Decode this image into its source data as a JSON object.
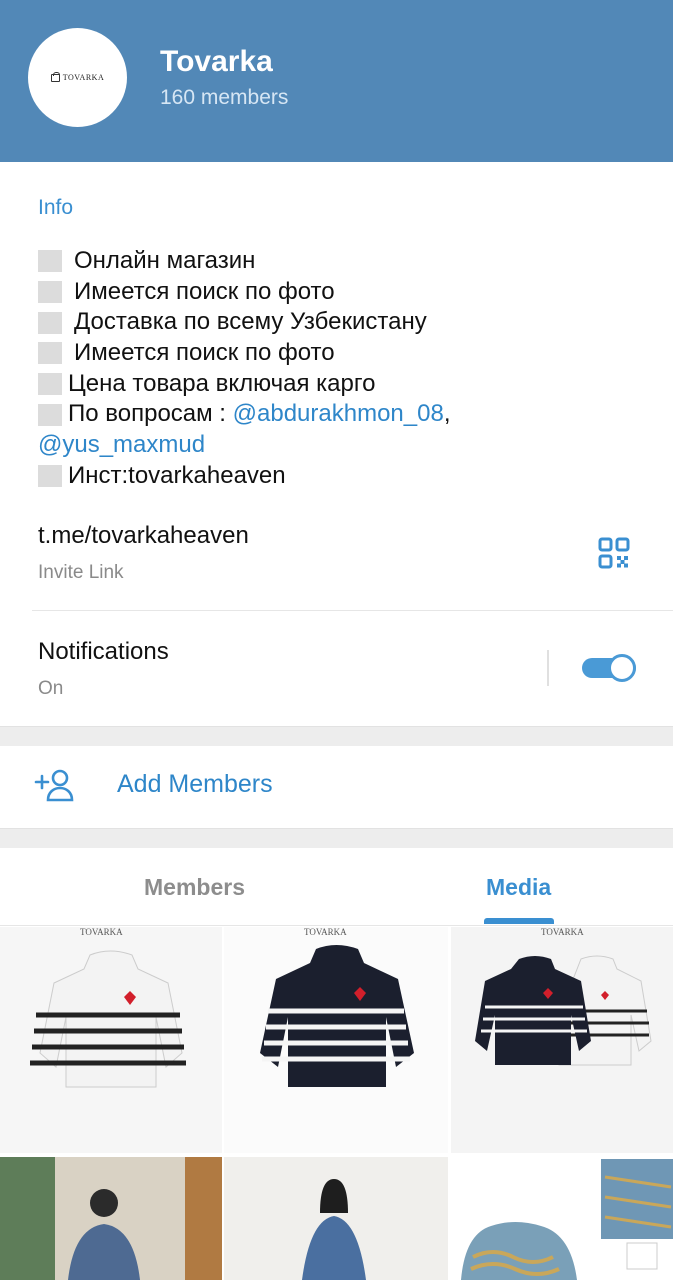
{
  "header": {
    "avatar_text": "TOVARKA",
    "title": "Tovarka",
    "subtitle": "160 members"
  },
  "info": {
    "label": "Info",
    "lines": [
      "Онлайн магазин",
      "Имеется поиск по фото",
      "Доставка по всему Узбекистану",
      "Имеется поиск по фото",
      "Цена товара включая карго",
      "По вопросам : "
    ],
    "mention1": "@abdurakhmon_08",
    "comma": ",",
    "mention2": "@yus_maxmud",
    "last_line": "Инст:tovarkaheaven"
  },
  "link": {
    "url": "t.me/tovarkaheaven",
    "caption": "Invite Link",
    "icon": "qr-code-icon"
  },
  "notifications": {
    "label": "Notifications",
    "state": "On",
    "enabled": true
  },
  "add_members": {
    "label": "Add Members",
    "icon": "add-person-icon"
  },
  "tabs": {
    "members": "Members",
    "media": "Media",
    "active": "Media"
  },
  "colors": {
    "header_bg": "#5288b7",
    "accent": "#3a8fd1",
    "link": "#2e86c9"
  },
  "media": {
    "watermark": "TOVARKA"
  }
}
